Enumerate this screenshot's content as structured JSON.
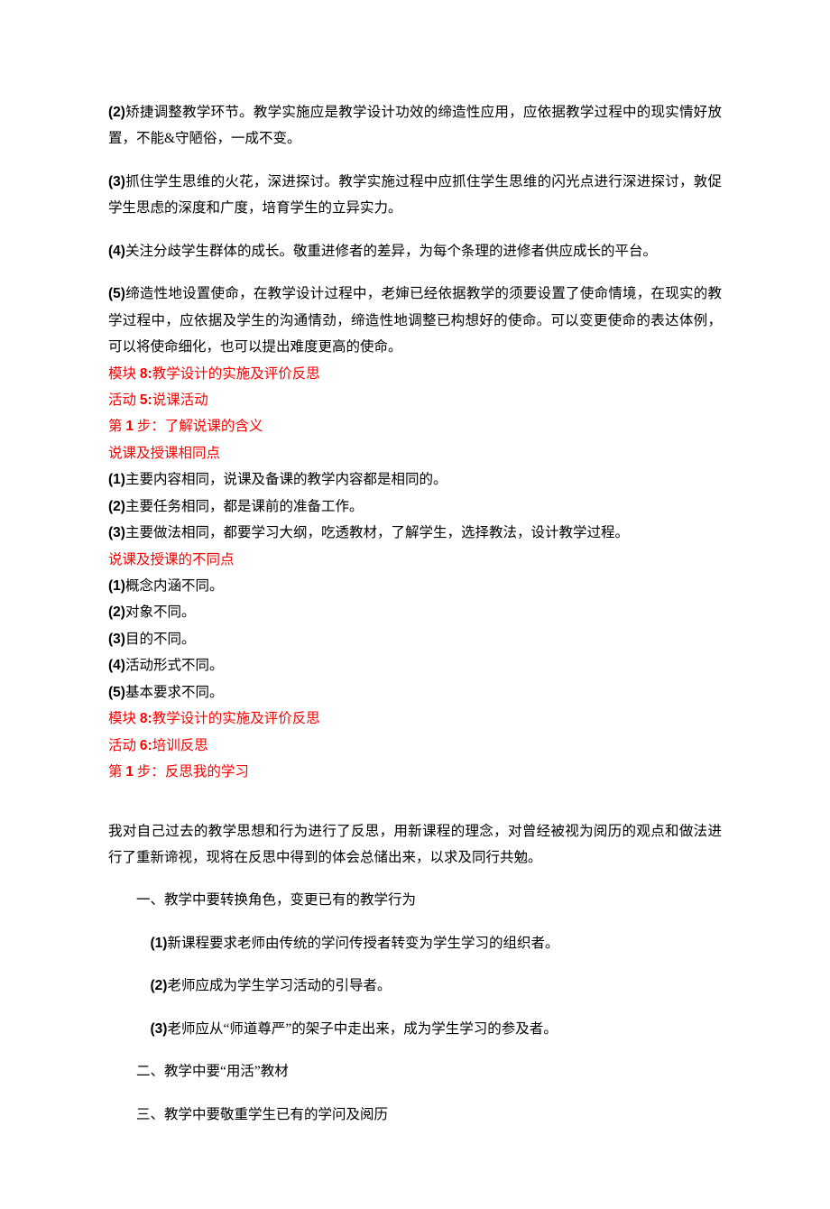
{
  "p1": {
    "num": "(2)",
    "text": "矫捷调整教学环节。教学实施应是教学设计功效的缔造性应用，应依据教学过程中的现实情好放置，不能&守陋俗，一成不变。"
  },
  "p2": {
    "num": "(3)",
    "text": "抓住学生思维的火花，深进探讨。教学实施过程中应抓住学生思维的闪光点进行深进探讨，敦促学生思虑的深度和广度，培育学生的立异实力。"
  },
  "p3": {
    "num": "(4)",
    "text": "关注分歧学生群体的成长。敬重进修者的差异，为每个条理的进修者供应成长的平台。"
  },
  "p4": {
    "num": "(5)",
    "text": "缔造性地设置使命，在教学设计过程中，老婶已经依据教学的须要设置了使命情境，在现实的教学过程中，应依据及学生的沟通情劲，缔造性地调整已构想好的使命。可以变更使命的表达体例，可以将使命细化，也可以提出难度更高的使命。"
  },
  "red1": {
    "prefix": "模块 ",
    "num": "8:",
    "text": "教学设计的实施及评价反思"
  },
  "red2": {
    "prefix": "活动 ",
    "num": "5:",
    "text": "说课活动"
  },
  "red3": {
    "prefix": "第 ",
    "num": "1",
    "text": " 步：了解说课的含义"
  },
  "red4": "说课及授课相同点",
  "list1": {
    "i1n": "(1)",
    "i1t": "主要内容相同，说课及备课的教学内容都是相同的。",
    "i2n": "(2)",
    "i2t": "主要任务相同，都是课前的准备工作。",
    "i3n": "(3)",
    "i3t": "主要做法相同，都要学习大纲，吃透教材，了解学生，选择教法，设计教学过程。"
  },
  "red5": "说课及授课的不同点",
  "list2": {
    "i1n": "(1)",
    "i1t": "概念内涵不同。",
    "i2n": "(2)",
    "i2t": "对象不同。",
    "i3n": "(3)",
    "i3t": "目的不同。",
    "i4n": "(4)",
    "i4t": "活动形式不同。",
    "i5n": "(5)",
    "i5t": "基本要求不同。"
  },
  "red6": {
    "prefix": "模块 ",
    "num": "8:",
    "text": "教学设计的实施及评价反思"
  },
  "red7": {
    "prefix": "活动 ",
    "num": "6:",
    "text": "培训反思"
  },
  "red8": {
    "prefix": "第 ",
    "num": "1",
    "text": " 步：反思我的学习"
  },
  "p5": "我对自己过去的教学思想和行为进行了反思，用新课程的理念，对曾经被视为阅历的观点和做法进行了重新谛视，现将在反思中得到的体会总储出来，以求及同行共勉。",
  "h1": "一、教学中要转换角色，变更已有的教学行为",
  "sub": {
    "i1n": "(1)",
    "i1t": "新课程要求老师由传统的学问传授者转变为学生学习的组织者。",
    "i2n": "(2)",
    "i2t": "老师应成为学生学习活动的引导者。",
    "i3n": "(3)",
    "i3t": "老师应从“师道尊严”的架子中走出来，成为学生学习的参及者。"
  },
  "h2": "二、教学中要“用活”教材",
  "h3": "三、教学中要敬重学生已有的学问及阅历"
}
